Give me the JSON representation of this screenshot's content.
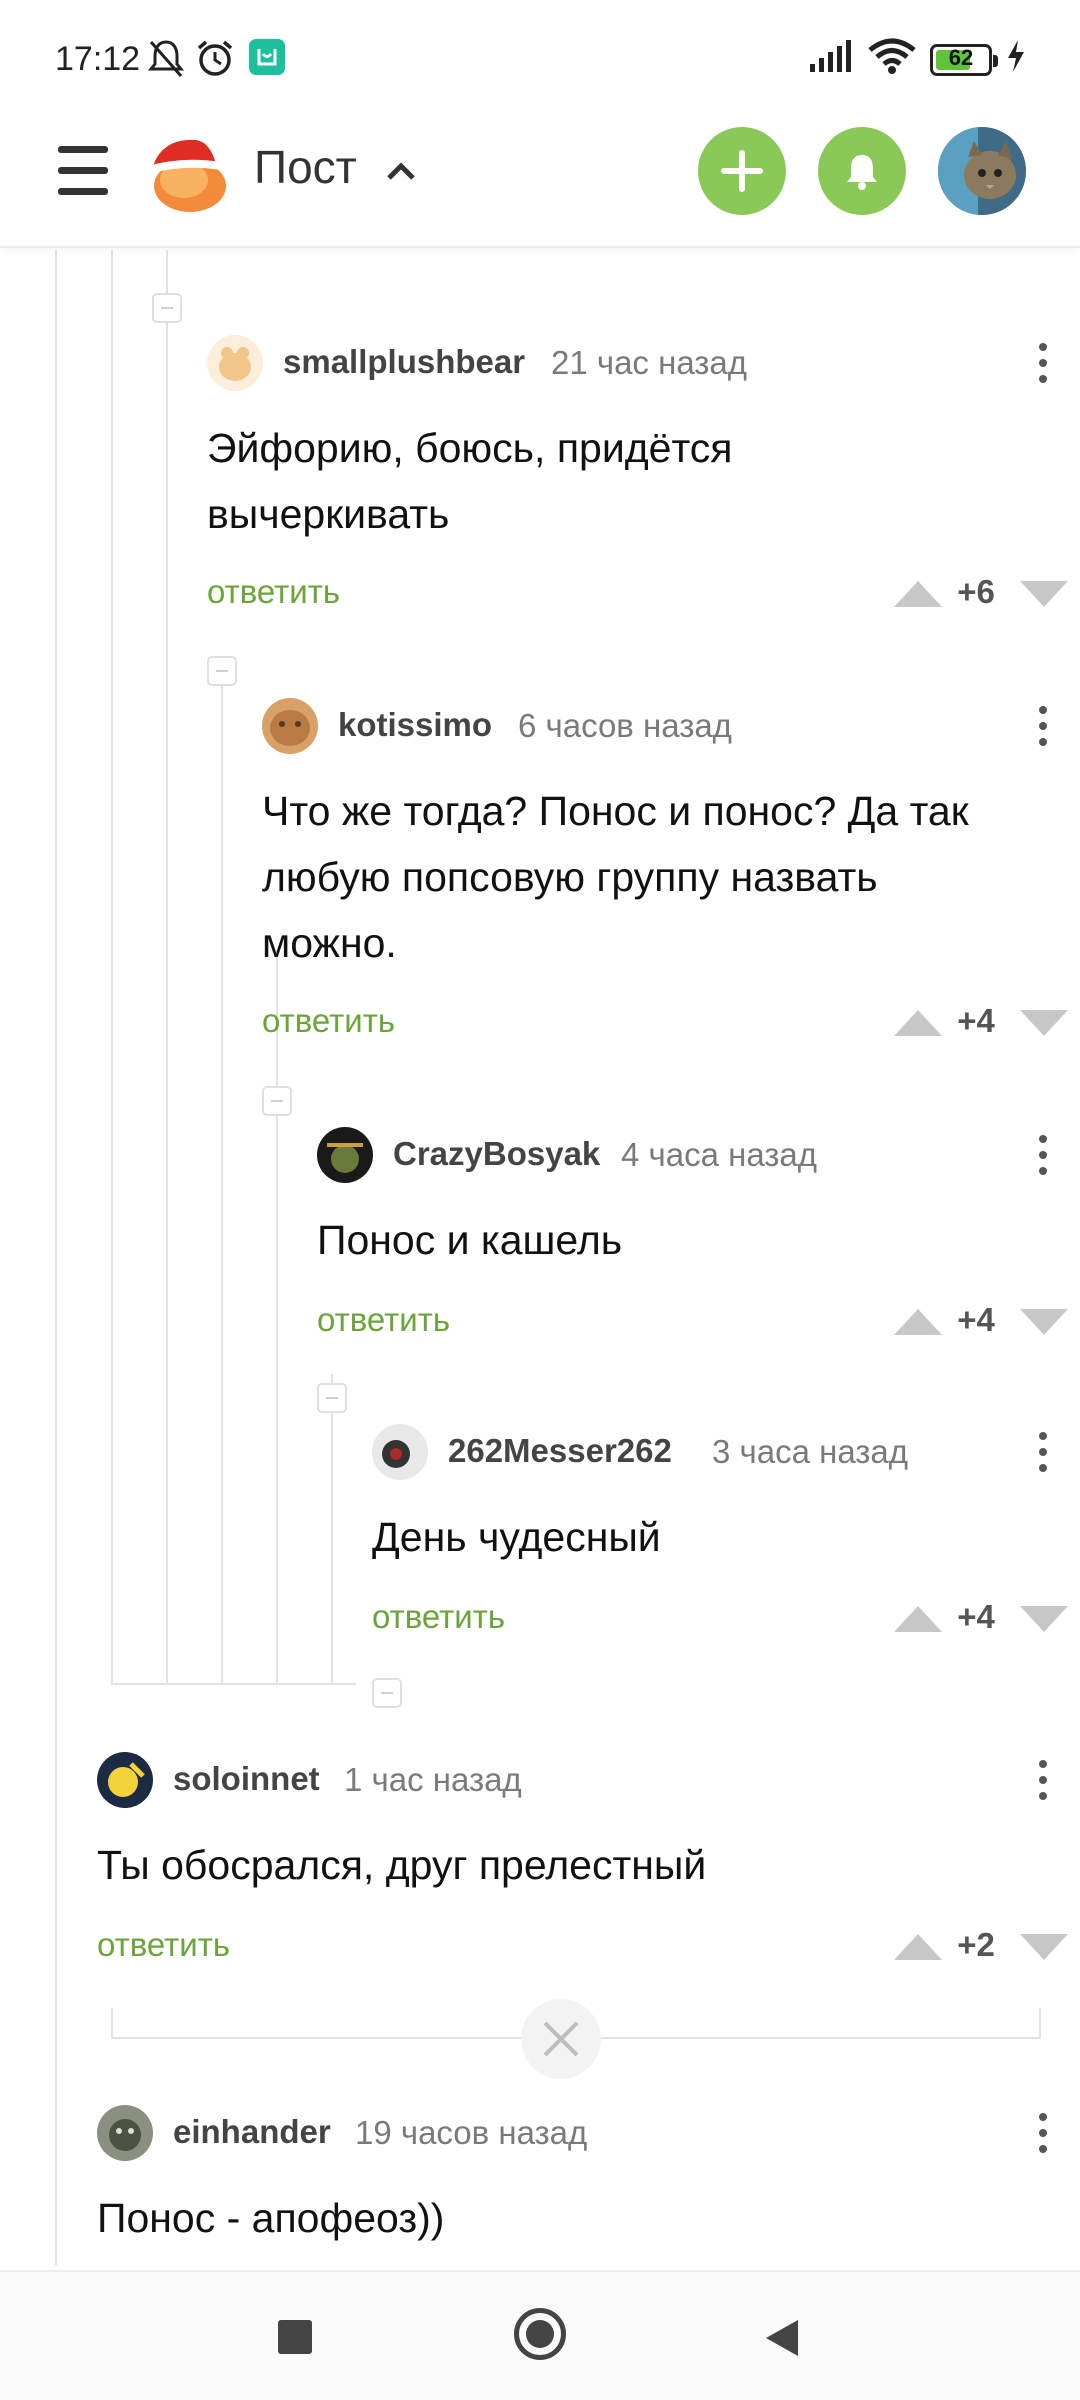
{
  "status_bar": {
    "time": "17:12",
    "battery": "62"
  },
  "header": {
    "title": "Пост"
  },
  "comments": [
    {
      "author": "smallplushbear",
      "time": "21 час назад",
      "text": "Эйфорию, боюсь, придётся\nвычеркивать",
      "reply": "ответить",
      "score": "+6"
    },
    {
      "author": "kotissimo",
      "time": "6 часов назад",
      "text": "Что же тогда? Понос и понос? Да так\nлюбую попсовую группу назвать\nможно.",
      "reply": "ответить",
      "score": "+4"
    },
    {
      "author": "CrazyBosyak",
      "time": "4 часа назад",
      "text": "Понос и кашель",
      "reply": "ответить",
      "score": "+4"
    },
    {
      "author": "262Messer262",
      "time": "3 часа назад",
      "text": "День чудесный",
      "reply": "ответить",
      "score": "+4"
    },
    {
      "author": "soloinnet",
      "time": "1 час назад",
      "text": "Ты обосрался, друг прелестный",
      "reply": "ответить",
      "score": "+2"
    },
    {
      "author": "einhander",
      "time": "19 часов назад",
      "text": "Понос - апофеоз))",
      "reply": "",
      "score": ""
    }
  ],
  "colors": {
    "accent": "#8ac858",
    "reply": "#6aa43a"
  }
}
